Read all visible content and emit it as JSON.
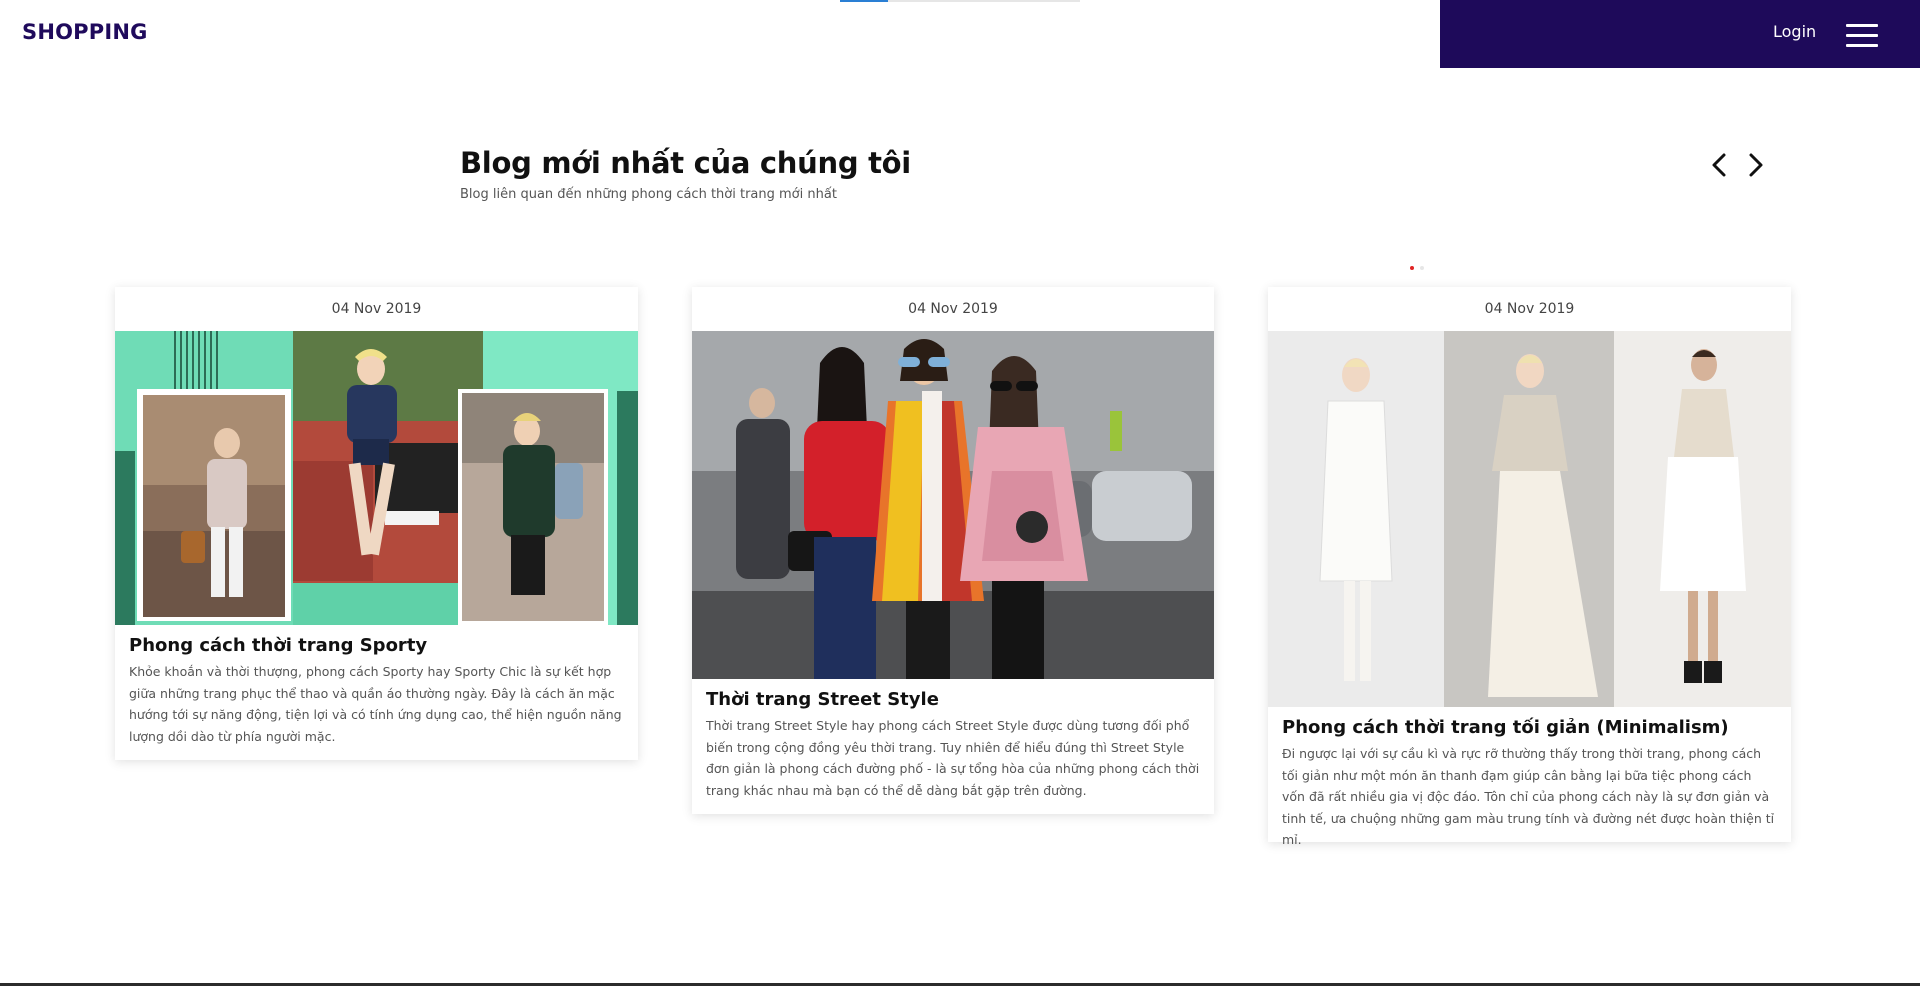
{
  "header": {
    "logo": "SHOPPING",
    "login_label": "Login",
    "menu_icon": "hamburger-menu-icon",
    "brand_color": "#1e0a5a",
    "progress": 0.2
  },
  "section": {
    "title": "Blog mới nhất của chúng tôi",
    "subtitle": "Blog liên quan đến những phong cách thời trang mới nhất",
    "prev_icon": "chevron-left-icon",
    "next_icon": "chevron-right-icon",
    "pagination": {
      "active_index": 0,
      "count": 2,
      "active_color": "#e02424"
    }
  },
  "posts": [
    {
      "date": "04 Nov 2019",
      "title": "Phong cách thời trang Sporty",
      "excerpt": "Khỏe khoắn và thời thượng, phong cách Sporty hay Sporty Chic là sự kết hợp giữa những trang phục thể thao và quần áo thường ngày. Đây là cách ăn mặc hướng tới sự năng động, tiện lợi và có tính ứng dụng cao, thể hiện nguồn năng lượng dồi dào từ phía người mặc."
    },
    {
      "date": "04 Nov 2019",
      "title": "Thời trang Street Style",
      "excerpt": "Thời trang Street Style hay phong cách Street Style được dùng tương đối phổ biến trong cộng đồng yêu thời trang. Tuy nhiên để hiểu đúng thì Street Style đơn giản là phong cách đường phố - là sự tổng hòa của những phong cách thời trang khác nhau mà bạn có thể dễ dàng bắt gặp trên đường."
    },
    {
      "date": "04 Nov 2019",
      "title": "Phong cách thời trang tối giản (Minimalism)",
      "excerpt": "Đi ngược lại với sự cầu kì và rực rỡ thường thấy trong thời trang, phong cách tối giản như một món ăn thanh đạm giúp cân bằng lại bữa tiệc phong cách vốn đã rất nhiều gia vị độc đáo. Tôn chỉ của phong cách này là sự đơn giản và tinh tế, ưa chuộng những gam màu trung tính và đường nét được hoàn thiện tỉ mỉ."
    }
  ]
}
